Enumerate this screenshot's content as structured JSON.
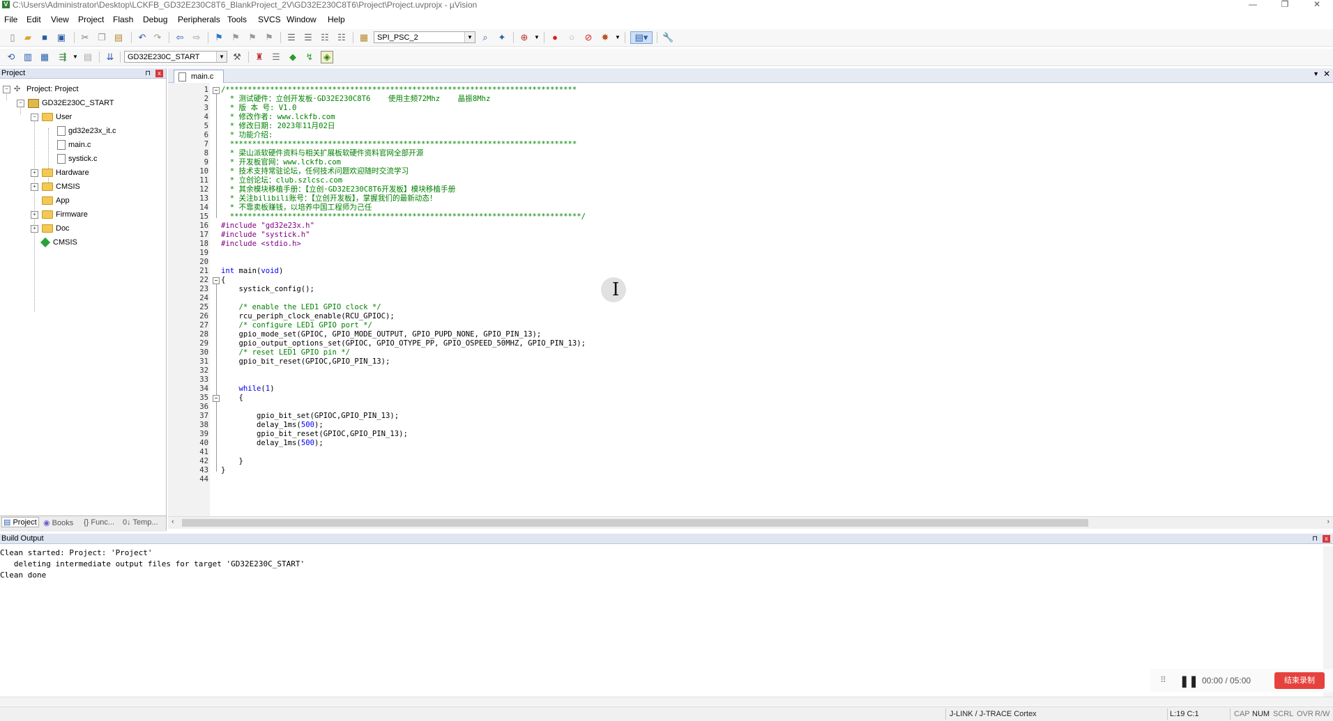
{
  "window": {
    "title": "C:\\Users\\Administrator\\Desktop\\LCKFB_GD32E230C8T6_BlankProject_2V\\GD32E230C8T6\\Project\\Project.uvprojx - µVision",
    "minimize": "—",
    "maximize": "❐",
    "close": "✕"
  },
  "menu": [
    "File",
    "Edit",
    "View",
    "Project",
    "Flash",
    "Debug",
    "Peripherals",
    "Tools",
    "SVCS",
    "Window",
    "Help"
  ],
  "toolbar1": {
    "find_combo_value": "SPI_PSC_2"
  },
  "toolbar2": {
    "target_combo_value": "GD32E230C_START"
  },
  "project_panel": {
    "title": "Project",
    "pin": "⊓",
    "close": "x",
    "tree": {
      "root": "Project: Project",
      "target": "GD32E230C_START",
      "groups": [
        {
          "name": "User",
          "files": [
            "gd32e23x_it.c",
            "main.c",
            "systick.c"
          ]
        },
        {
          "name": "Hardware"
        },
        {
          "name": "CMSIS"
        },
        {
          "name": "App"
        },
        {
          "name": "Firmware"
        },
        {
          "name": "Doc"
        }
      ],
      "component": "CMSIS"
    },
    "tabs": [
      "Project",
      "Books",
      "{} Func...",
      "0↓ Temp..."
    ]
  },
  "editor": {
    "tab": "main.c",
    "lines": [
      [
        [
          "c-comment",
          "/*******************************************************************************"
        ]
      ],
      [
        [
          "c-comment",
          "  * 测试硬件：立创开发板·GD32E230C8T6    使用主频72Mhz    晶振8Mhz"
        ]
      ],
      [
        [
          "c-comment",
          "  * 版 本 号: V1.0"
        ]
      ],
      [
        [
          "c-comment",
          "  * 修改作者: www.lckfb.com"
        ]
      ],
      [
        [
          "c-comment",
          "  * 修改日期: 2023年11月02日"
        ]
      ],
      [
        [
          "c-comment",
          "  * 功能介绍:"
        ]
      ],
      [
        [
          "c-comment",
          "  ******************************************************************************"
        ]
      ],
      [
        [
          "c-comment",
          "  * 梁山派软硬件资料与相关扩展板软硬件资料官网全部开源"
        ]
      ],
      [
        [
          "c-comment",
          "  * 开发板官网：www.lckfb.com"
        ]
      ],
      [
        [
          "c-comment",
          "  * 技术支持常驻论坛，任何技术问题欢迎随时交流学习"
        ]
      ],
      [
        [
          "c-comment",
          "  * 立创论坛：club.szlcsc.com"
        ]
      ],
      [
        [
          "c-comment",
          "  * 其余模块移植手册：【立创·GD32E230C8T6开发板】模块移植手册"
        ]
      ],
      [
        [
          "c-comment",
          "  * 关注bilibili账号：【立创开发板】，掌握我们的最新动态！"
        ]
      ],
      [
        [
          "c-comment",
          "  * 不靠卖板赚钱，以培养中国工程师为己任"
        ]
      ],
      [
        [
          "c-comment",
          "  *******************************************************************************/"
        ]
      ],
      [
        [
          "c-pre",
          "#include "
        ],
        [
          "c-str",
          "\"gd32e23x.h\""
        ]
      ],
      [
        [
          "c-pre",
          "#include "
        ],
        [
          "c-str",
          "\"systick.h\""
        ]
      ],
      [
        [
          "c-pre",
          "#include "
        ],
        [
          "c-str",
          "<stdio.h>"
        ]
      ],
      [],
      [],
      [
        [
          "c-kw",
          "int"
        ],
        [
          "c-plain",
          " main("
        ],
        [
          "c-kw",
          "void"
        ],
        [
          "c-plain",
          ")"
        ]
      ],
      [
        [
          "c-plain",
          "{"
        ]
      ],
      [
        [
          "c-plain",
          "    systick_config();"
        ]
      ],
      [],
      [
        [
          "c-comment",
          "    /* enable the LED1 GPIO clock */"
        ]
      ],
      [
        [
          "c-plain",
          "    rcu_periph_clock_enable(RCU_GPIOC);"
        ]
      ],
      [
        [
          "c-comment",
          "    /* configure LED1 GPIO port */"
        ]
      ],
      [
        [
          "c-plain",
          "    gpio_mode_set(GPIOC, GPIO_MODE_OUTPUT, GPIO_PUPD_NONE, GPIO_PIN_13);"
        ]
      ],
      [
        [
          "c-plain",
          "    gpio_output_options_set(GPIOC, GPIO_OTYPE_PP, GPIO_OSPEED_50MHZ, GPIO_PIN_13);"
        ]
      ],
      [
        [
          "c-comment",
          "    /* reset LED1 GPIO pin */"
        ]
      ],
      [
        [
          "c-plain",
          "    gpio_bit_reset(GPIOC,GPIO_PIN_13);"
        ]
      ],
      [],
      [],
      [
        [
          "c-plain",
          "    "
        ],
        [
          "c-kw",
          "while"
        ],
        [
          "c-plain",
          "("
        ],
        [
          "c-num",
          "1"
        ],
        [
          "c-plain",
          ")"
        ]
      ],
      [
        [
          "c-plain",
          "    {"
        ]
      ],
      [],
      [
        [
          "c-plain",
          "        gpio_bit_set(GPIOC,GPIO_PIN_13);"
        ]
      ],
      [
        [
          "c-plain",
          "        delay_1ms("
        ],
        [
          "c-num",
          "500"
        ],
        [
          "c-plain",
          ");"
        ]
      ],
      [
        [
          "c-plain",
          "        gpio_bit_reset(GPIOC,GPIO_PIN_13);"
        ]
      ],
      [
        [
          "c-plain",
          "        delay_1ms("
        ],
        [
          "c-num",
          "500"
        ],
        [
          "c-plain",
          ");"
        ]
      ],
      [],
      [
        [
          "c-plain",
          "    }"
        ]
      ],
      [
        [
          "c-plain",
          "}"
        ]
      ],
      []
    ]
  },
  "build_output": {
    "title": "Build Output",
    "text": "Clean started: Project: 'Project'\n   deleting intermediate output files for target 'GD32E230C_START'\nClean done"
  },
  "recorder": {
    "grip": "⠿",
    "pause": "❚❚",
    "time": "00:00 / 05:00",
    "stop_label": "结束录制"
  },
  "status": {
    "debugger": "J-LINK / J-TRACE Cortex",
    "position": "L:19 C:1",
    "cap": "CAP",
    "num": "NUM",
    "scrl": "SCRL",
    "ovr": "OVR",
    "rw": "R/W"
  },
  "colors": {
    "comment": "#008000",
    "preprocessor": "#800080",
    "keyword": "#0000ff",
    "stop_button": "#e5423e"
  }
}
